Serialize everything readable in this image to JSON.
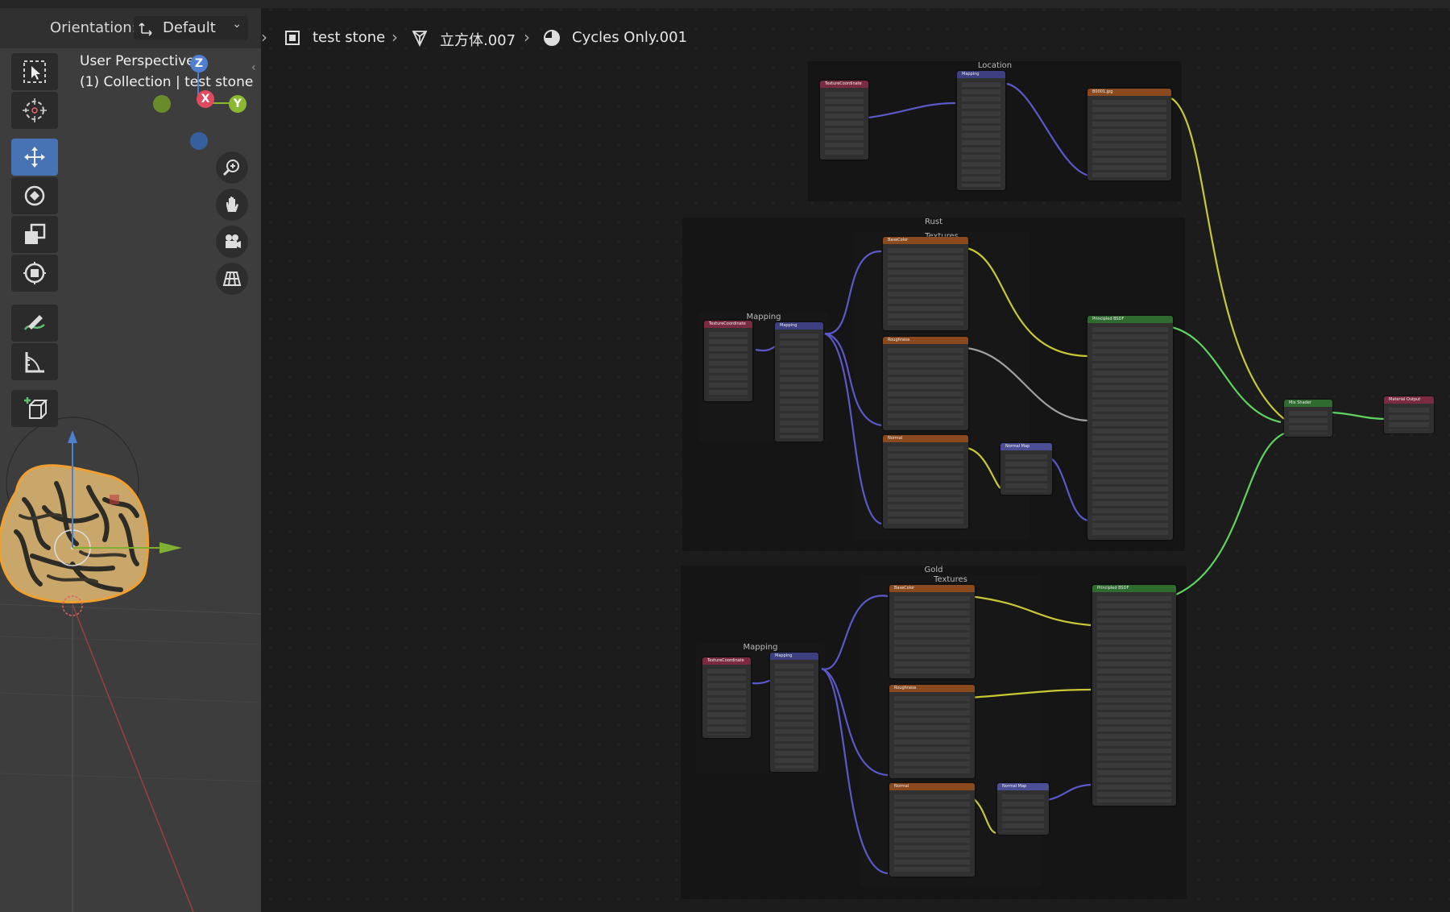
{
  "viewport": {
    "orientation_label": "Orientation:",
    "orientation_value": "Default",
    "view_name": "User Perspective",
    "collection_line": "(1) Collection | test stone",
    "axis_x": "X",
    "axis_y": "Y",
    "axis_z": "Z"
  },
  "breadcrumb": {
    "object": "test stone",
    "mesh": "立方体.007",
    "material": "Cycles Only.001"
  },
  "frames": {
    "location": "Location",
    "rust": "Rust",
    "rust_textures": "Textures",
    "rust_mapping": "Mapping",
    "gold": "Gold",
    "gold_textures": "Textures",
    "gold_mapping": "Mapping"
  },
  "nodes": {
    "tex_coord": "TextureCoordinate",
    "mapping": "Mapping",
    "image_loc": "B0001.jpg",
    "base_color": "BaseColor",
    "roughness": "Roughness",
    "normal": "Normal",
    "normal_map": "Normal Map",
    "principled": "Principled BSDF",
    "mix_shader": "Mix Shader",
    "material_output": "Material Output"
  }
}
